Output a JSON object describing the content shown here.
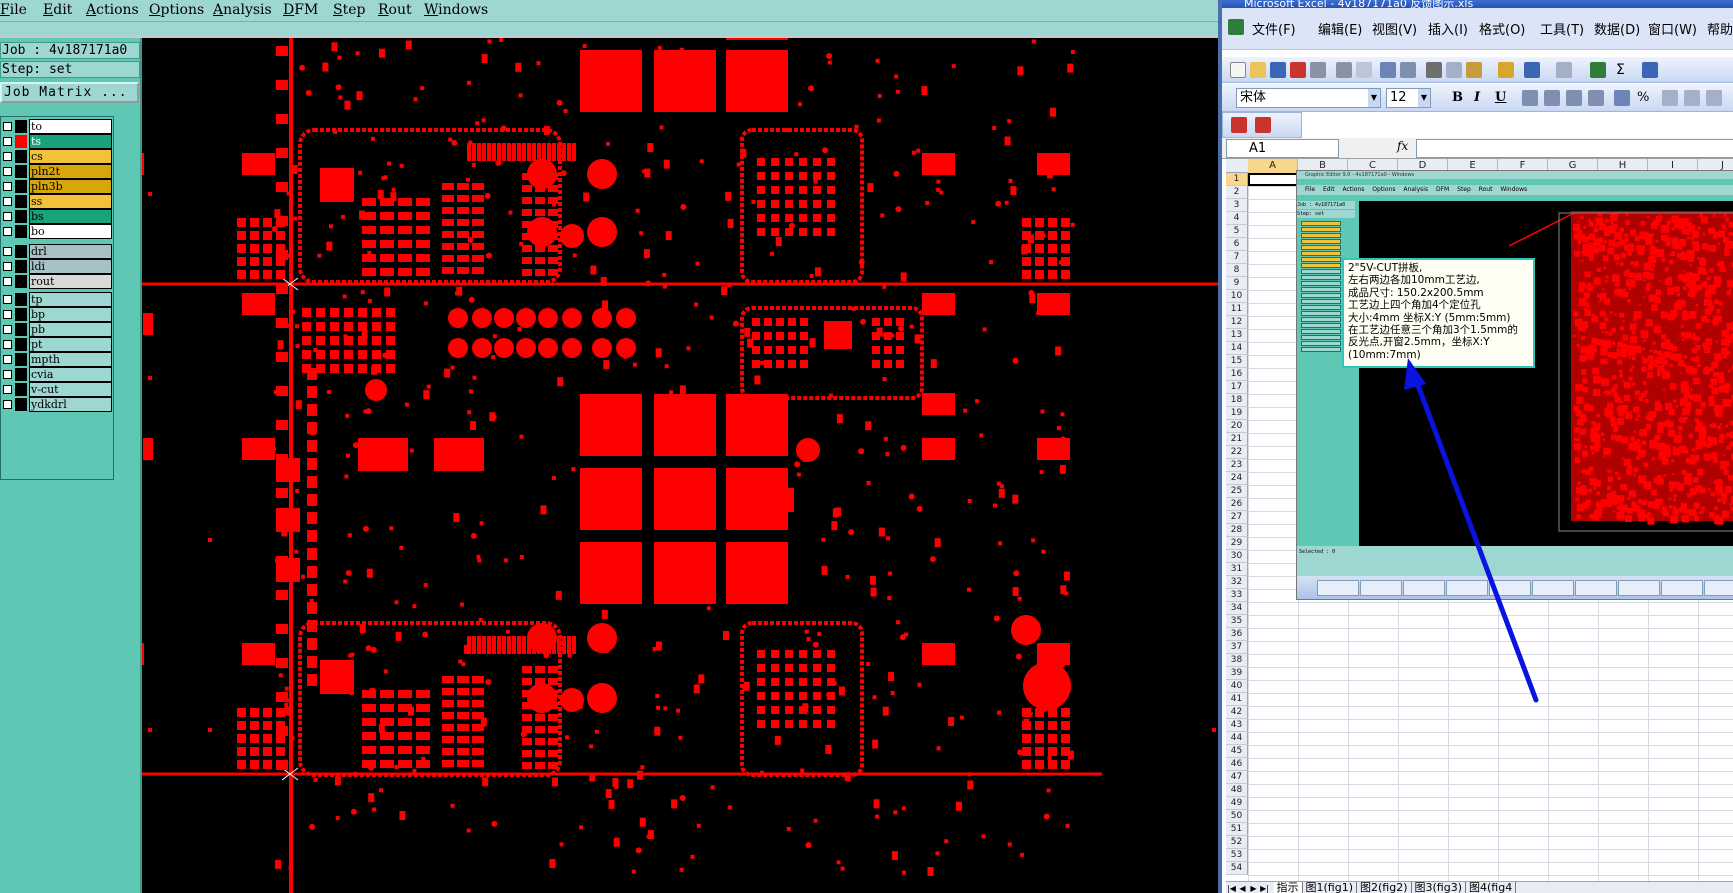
{
  "left_app": {
    "menu": [
      "File",
      "Edit",
      "Actions",
      "Options",
      "Analysis",
      "DFM",
      "Step",
      "Rout",
      "Windows"
    ],
    "job_line": "Job : 4v187171a0",
    "step_line": "Step: set",
    "job_matrix_label": "Job Matrix ...",
    "layers": [
      {
        "name": "to",
        "color": "#ffffff",
        "swatch": "#000000"
      },
      {
        "name": "ts",
        "color": "#1aa37a",
        "swatch": "#ff0000",
        "current": true
      },
      {
        "name": "cs",
        "color": "#f2c23a",
        "swatch": "#000000"
      },
      {
        "name": "pln2t",
        "color": "#d6a60a",
        "swatch": "#000000"
      },
      {
        "name": "pln3b",
        "color": "#d6a60a",
        "swatch": "#000000"
      },
      {
        "name": "ss",
        "color": "#f2c23a",
        "swatch": "#000000"
      },
      {
        "name": "bs",
        "color": "#1aa37a",
        "swatch": "#000000"
      },
      {
        "name": "bo",
        "color": "#ffffff",
        "swatch": "#000000"
      },
      {
        "name": "drl",
        "color": "#a7c2c7",
        "swatch": "#000000"
      },
      {
        "name": "ldi",
        "color": "#a7c2c7",
        "swatch": "#000000"
      },
      {
        "name": "rout",
        "color": "#d9d9d9",
        "swatch": "#000000"
      },
      {
        "name": "tp",
        "color": "#9ed6d2",
        "swatch": "#000000"
      },
      {
        "name": "bp",
        "color": "#9ed6d2",
        "swatch": "#000000"
      },
      {
        "name": "pb",
        "color": "#9ed6d2",
        "swatch": "#000000"
      },
      {
        "name": "pt",
        "color": "#9ed6d2",
        "swatch": "#000000"
      },
      {
        "name": "mpth",
        "color": "#9ed6d2",
        "swatch": "#000000"
      },
      {
        "name": "cvia",
        "color": "#9ed6d2",
        "swatch": "#000000"
      },
      {
        "name": "v-cut",
        "color": "#9ed6d2",
        "swatch": "#000000"
      },
      {
        "name": "ydkdrl",
        "color": "#9ed6d2",
        "swatch": "#000000"
      }
    ],
    "pad_color": "#ff0000"
  },
  "excel": {
    "title": "Microsoft Excel - 4v187171a0 反馈图示.xls",
    "menu": [
      "文件(F)",
      "编辑(E)",
      "视图(V)",
      "插入(I)",
      "格式(O)",
      "工具(T)",
      "数据(D)",
      "窗口(W)",
      "帮助"
    ],
    "font_name": "宋体",
    "font_size": "12",
    "format_buttons": [
      "B",
      "I",
      "U"
    ],
    "percent": "%",
    "name_box": "A1",
    "fx": "fx",
    "columns": [
      "A",
      "B",
      "C",
      "D",
      "E",
      "F",
      "G",
      "H",
      "I",
      "J"
    ],
    "row_count": 54,
    "sheet_tabs": [
      "指示",
      "图1(fig1)",
      "图2(fig2)",
      "图3(fig3)",
      "图4(fig4"
    ],
    "embedded": {
      "title": "Graphic Editor 9.0 - 4v187171a0 - Windows",
      "menu": "File Edit Actions Options Analysis DFM Step Rout Windows",
      "job": "Job : 4v187171a0",
      "step": "Step: set",
      "status": "Selected : 0",
      "taskbar": [
        "",
        "",
        "",
        "",
        "",
        "",
        "",
        "",
        "",
        ""
      ]
    },
    "note_lines": [
      "2\"5V-CUT拼板,",
      "左右两边各加10mm工艺边,",
      "成品尺寸: 150.2x200.5mm",
      "工艺边上四个角加4个定位孔",
      "大小:4mm   坐标X:Y (5mm:5mm)",
      "在工艺边任意三个角加3个1.5mm的",
      "反光点,开窗2.5mm，坐标X:Y",
      "(10mm:7mm)"
    ],
    "arrow_color": "#0a14e0"
  }
}
